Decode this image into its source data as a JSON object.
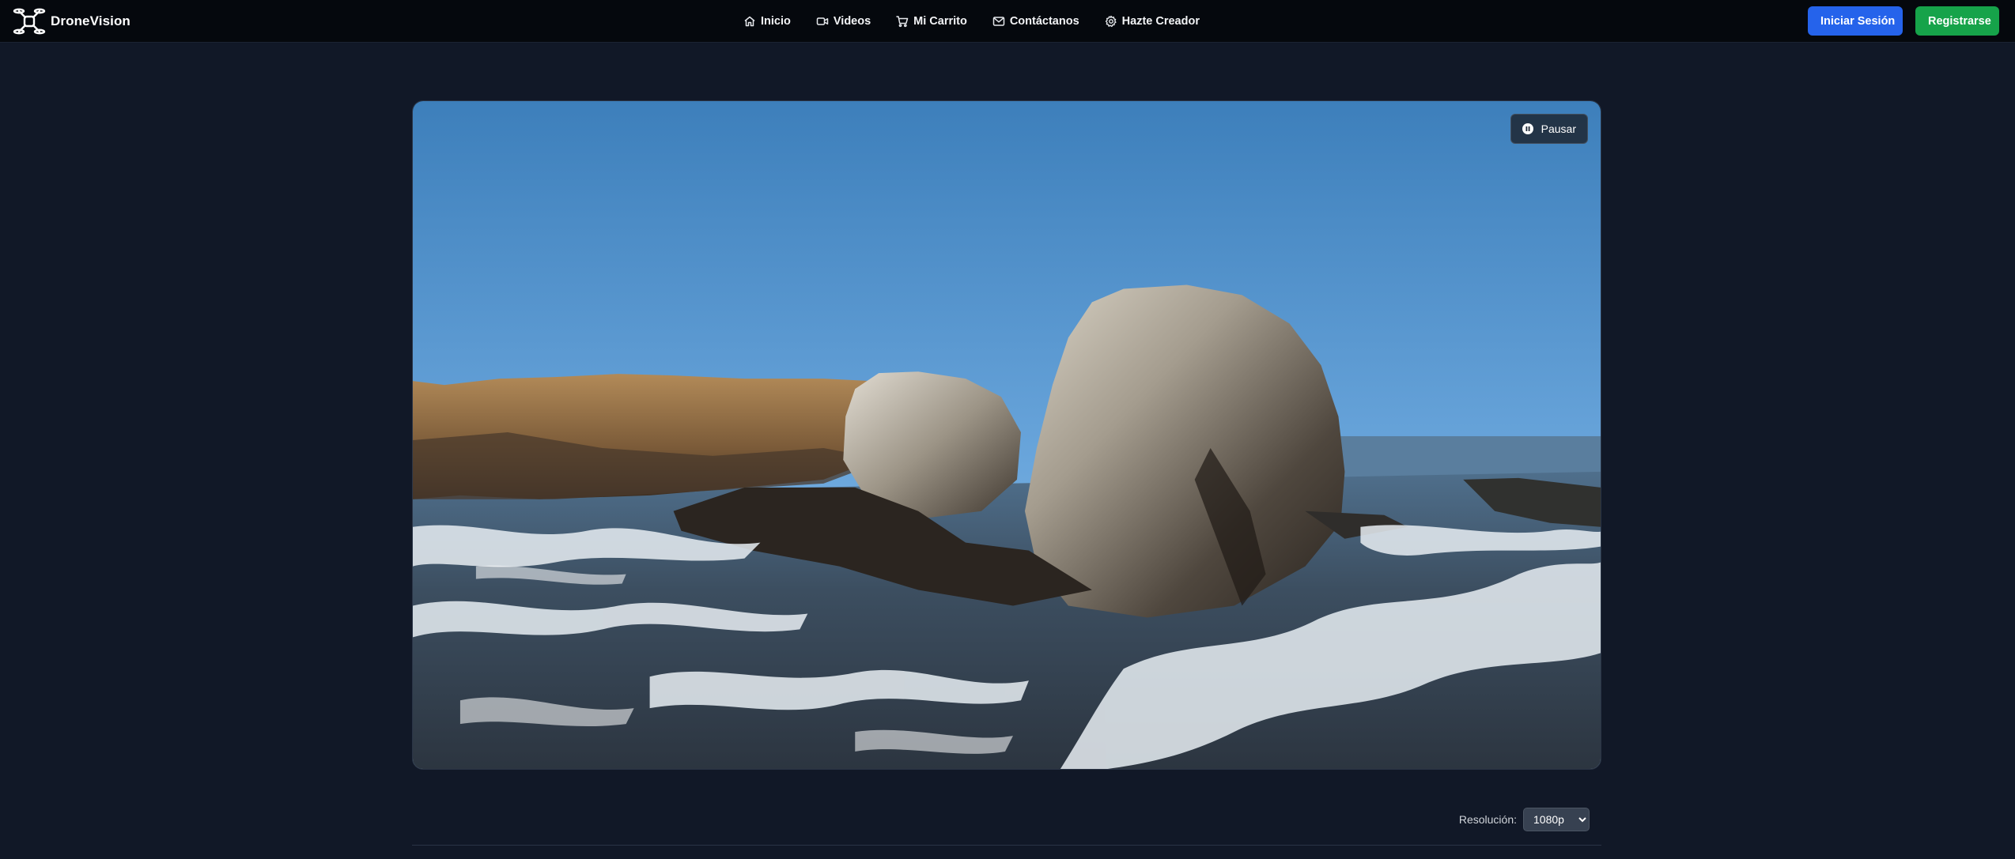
{
  "header": {
    "brand": "DroneVision",
    "nav": [
      {
        "label": "Inicio",
        "icon": "home-icon"
      },
      {
        "label": "Videos",
        "icon": "video-camera-icon"
      },
      {
        "label": "Mi Carrito",
        "icon": "cart-icon"
      },
      {
        "label": "Contáctanos",
        "icon": "mail-icon"
      },
      {
        "label": "Hazte Creador",
        "icon": "gear-icon"
      }
    ],
    "login_label": "Iniciar Sesión",
    "register_label": "Registrarse"
  },
  "player": {
    "pause_label": "Pausar",
    "pause_icon": "pause-icon"
  },
  "resolution": {
    "label": "Resolución:",
    "selected": "1080p"
  },
  "colors": {
    "page_bg": "#111827",
    "topbar_bg": "#05080d",
    "login_button": "#2563eb",
    "register_button": "#16a34a"
  }
}
